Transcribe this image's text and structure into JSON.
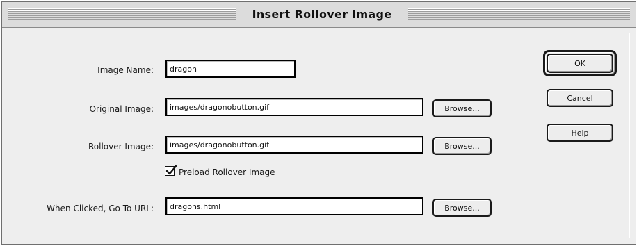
{
  "dialog": {
    "title": "Insert Rollover Image"
  },
  "form": {
    "image_name": {
      "label": "Image Name:",
      "value": "dragon"
    },
    "original_image": {
      "label": "Original Image:",
      "value": "images/dragonobutton.gif",
      "browse_label": "Browse..."
    },
    "rollover_image": {
      "label": "Rollover Image:",
      "value": "images/dragonobutton.gif",
      "browse_label": "Browse..."
    },
    "preload": {
      "label": "Preload Rollover Image",
      "checked": true
    },
    "url": {
      "label": "When Clicked, Go To URL:",
      "value": "dragons.html",
      "browse_label": "Browse..."
    }
  },
  "buttons": {
    "ok": "OK",
    "cancel": "Cancel",
    "help": "Help"
  }
}
